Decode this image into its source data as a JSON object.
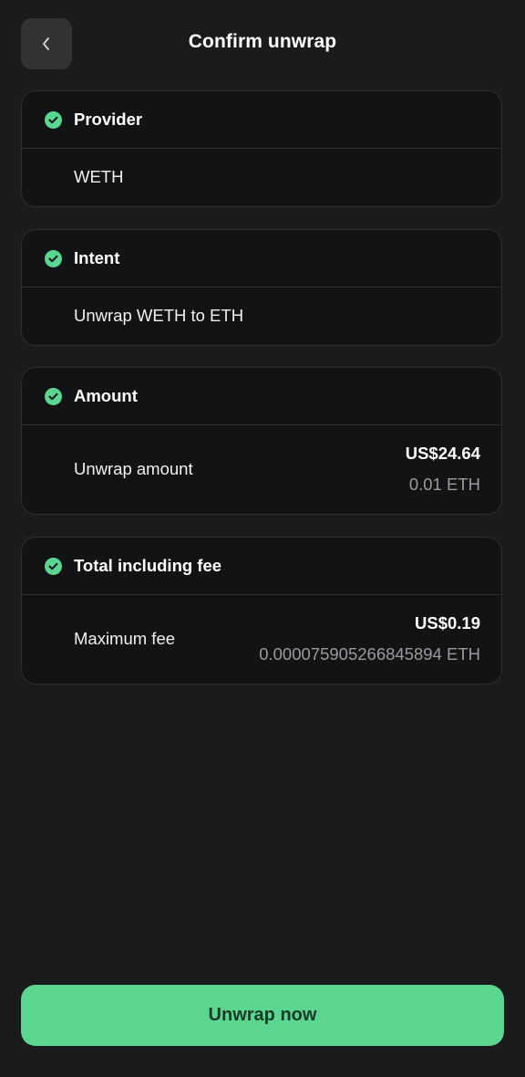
{
  "header": {
    "title": "Confirm unwrap"
  },
  "cards": {
    "provider": {
      "title": "Provider",
      "value": "WETH"
    },
    "intent": {
      "title": "Intent",
      "value": "Unwrap WETH to ETH"
    },
    "amount": {
      "title": "Amount",
      "label": "Unwrap amount",
      "usd": "US$24.64",
      "eth": "0.01 ETH"
    },
    "fee": {
      "title": "Total including fee",
      "label": "Maximum fee",
      "usd": "US$0.19",
      "eth": "0.000075905266845894 ETH"
    }
  },
  "cta": {
    "label": "Unwrap now"
  },
  "colors": {
    "background": "#1a1b1d",
    "card": "#121315",
    "accent": "#5bd691",
    "muted_text": "#9a9b9e"
  },
  "icons": {
    "back": "chevron-left-icon",
    "status": "check-circle-icon"
  }
}
